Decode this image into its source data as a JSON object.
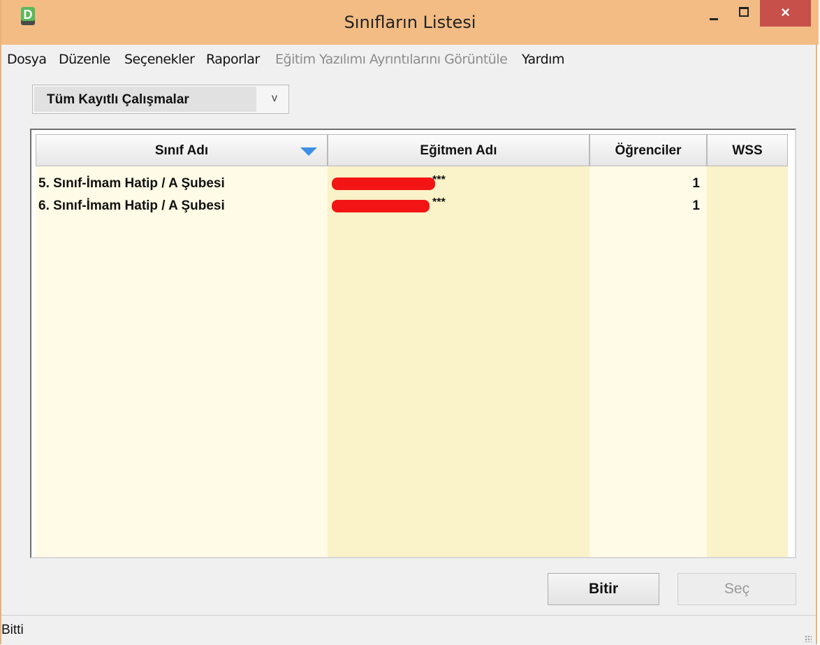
{
  "window": {
    "title": "Sınıfların Listesi",
    "app_icon_letter": "D",
    "minimize_icon": "minimize-icon",
    "maximize_icon": "maximize-icon",
    "close_icon": "close-icon",
    "close_label": "×"
  },
  "menu": {
    "items": [
      {
        "label": "Dosya",
        "enabled": true
      },
      {
        "label": "Düzenle",
        "enabled": true
      },
      {
        "label": "Seçenekler",
        "enabled": true
      },
      {
        "label": "Raporlar",
        "enabled": true
      },
      {
        "label": "Eğitim Yazılımı Ayrıntılarını Görüntüle",
        "enabled": false
      },
      {
        "label": "Yardım",
        "enabled": true
      }
    ]
  },
  "filter": {
    "selected": "Tüm Kayıtlı Çalışmalar",
    "chevron": "v"
  },
  "table": {
    "columns": [
      "Sınıf Adı",
      "Eğitmen Adı",
      "Öğrenciler",
      "WSS"
    ],
    "sort_indicator_icon": "sort-descending-icon",
    "rows": [
      {
        "class_name": "5. Sınıf-İmam Hatip / A Şubesi",
        "teacher_suffix": "***",
        "students": "1",
        "wss": ""
      },
      {
        "class_name": "6. Sınıf-İmam Hatip / A Şubesi",
        "teacher_suffix": "***",
        "students": "1",
        "wss": ""
      }
    ]
  },
  "buttons": {
    "finish": "Bitir",
    "select": "Seç"
  },
  "status": {
    "text": "Bitti"
  },
  "colors": {
    "titlebar": "#f2bc84",
    "close_button": "#c7504b",
    "column_light": "#fffbe6",
    "column_dark": "#faf2c8",
    "sort_arrow": "#3d8fe6",
    "redaction": "#f31515"
  }
}
